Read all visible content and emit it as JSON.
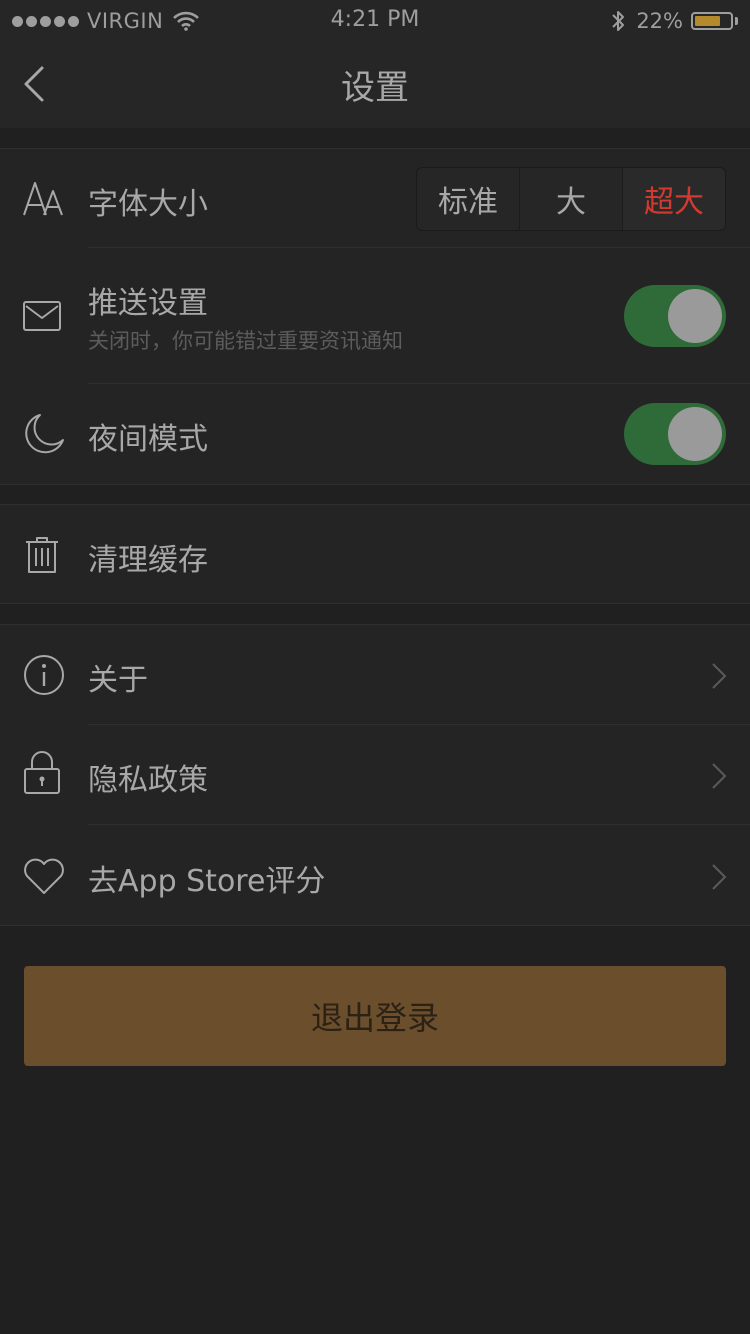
{
  "status_bar": {
    "carrier": "VIRGIN",
    "time": "4:21 PM",
    "battery_percent": "22%",
    "battery_level": 0.22,
    "icons": [
      "signal-dots-icon",
      "wifi-icon",
      "bluetooth-icon",
      "battery-icon"
    ]
  },
  "nav": {
    "title": "设置",
    "back_icon": "chevron-left-icon"
  },
  "font_size": {
    "label": "字体大小",
    "icon": "font-size-icon",
    "options": [
      "标准",
      "大",
      "超大"
    ],
    "selected": "超大"
  },
  "push": {
    "label": "推送设置",
    "sublabel": "关闭时，你可能错过重要资讯通知",
    "icon": "envelope-icon",
    "enabled": true
  },
  "night_mode": {
    "label": "夜间模式",
    "icon": "moon-icon",
    "enabled": true
  },
  "cache": {
    "label": "清理缓存",
    "icon": "trash-icon"
  },
  "about": {
    "label": "关于",
    "icon": "info-icon"
  },
  "privacy": {
    "label": "隐私政策",
    "icon": "lock-icon"
  },
  "rate": {
    "label": "去App Store评分",
    "icon": "heart-icon"
  },
  "logout": {
    "label": "退出登录"
  },
  "colors": {
    "background": "#202020",
    "toggle_on": "#2f6a39",
    "selected_option": "#d23a2f",
    "logout_button": "#6b4e2c",
    "battery_fill": "#b58a2c"
  }
}
